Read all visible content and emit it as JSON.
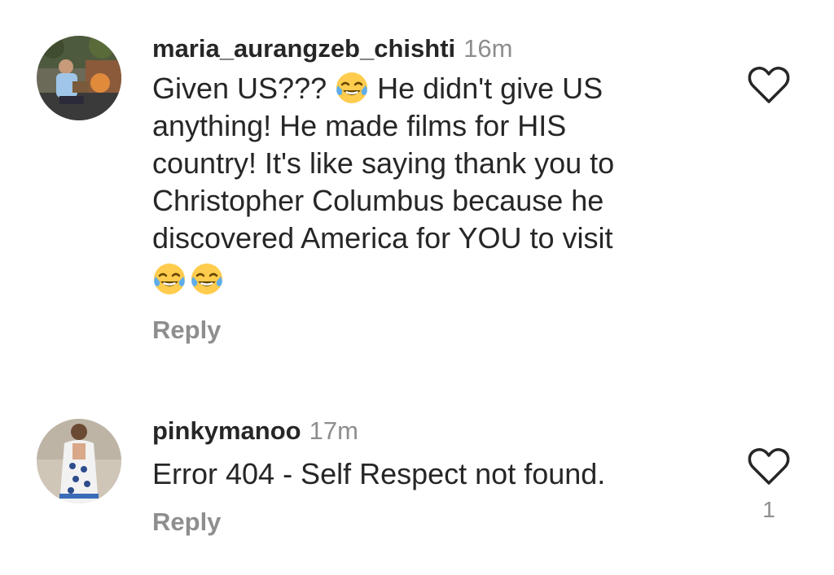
{
  "comments": [
    {
      "username": "maria_aurangzeb_chishti",
      "timestamp": "16m",
      "text_part1": "Given US??? ",
      "text_part2": " He didn't give US\nanything! He made films for HIS\ncountry! It's like saying thank you to\nChristopher Columbus because he\ndiscovered America for YOU to visit",
      "trailing_emojis": [
        "face-with-tears-of-joy",
        "face-with-tears-of-joy"
      ],
      "reply_label": "Reply",
      "like_count": ""
    },
    {
      "username": "pinkymanoo",
      "timestamp": "17m",
      "text": "Error 404 - Self Respect not found.",
      "reply_label": "Reply",
      "like_count": "1"
    }
  ],
  "colors": {
    "text": "#262626",
    "secondary": "#8e8e8e",
    "emoji_face": "#ffcc4d",
    "emoji_tears": "#5dadec"
  },
  "icons": {
    "like": "heart-outline-icon",
    "emoji": "face-with-tears-of-joy"
  }
}
